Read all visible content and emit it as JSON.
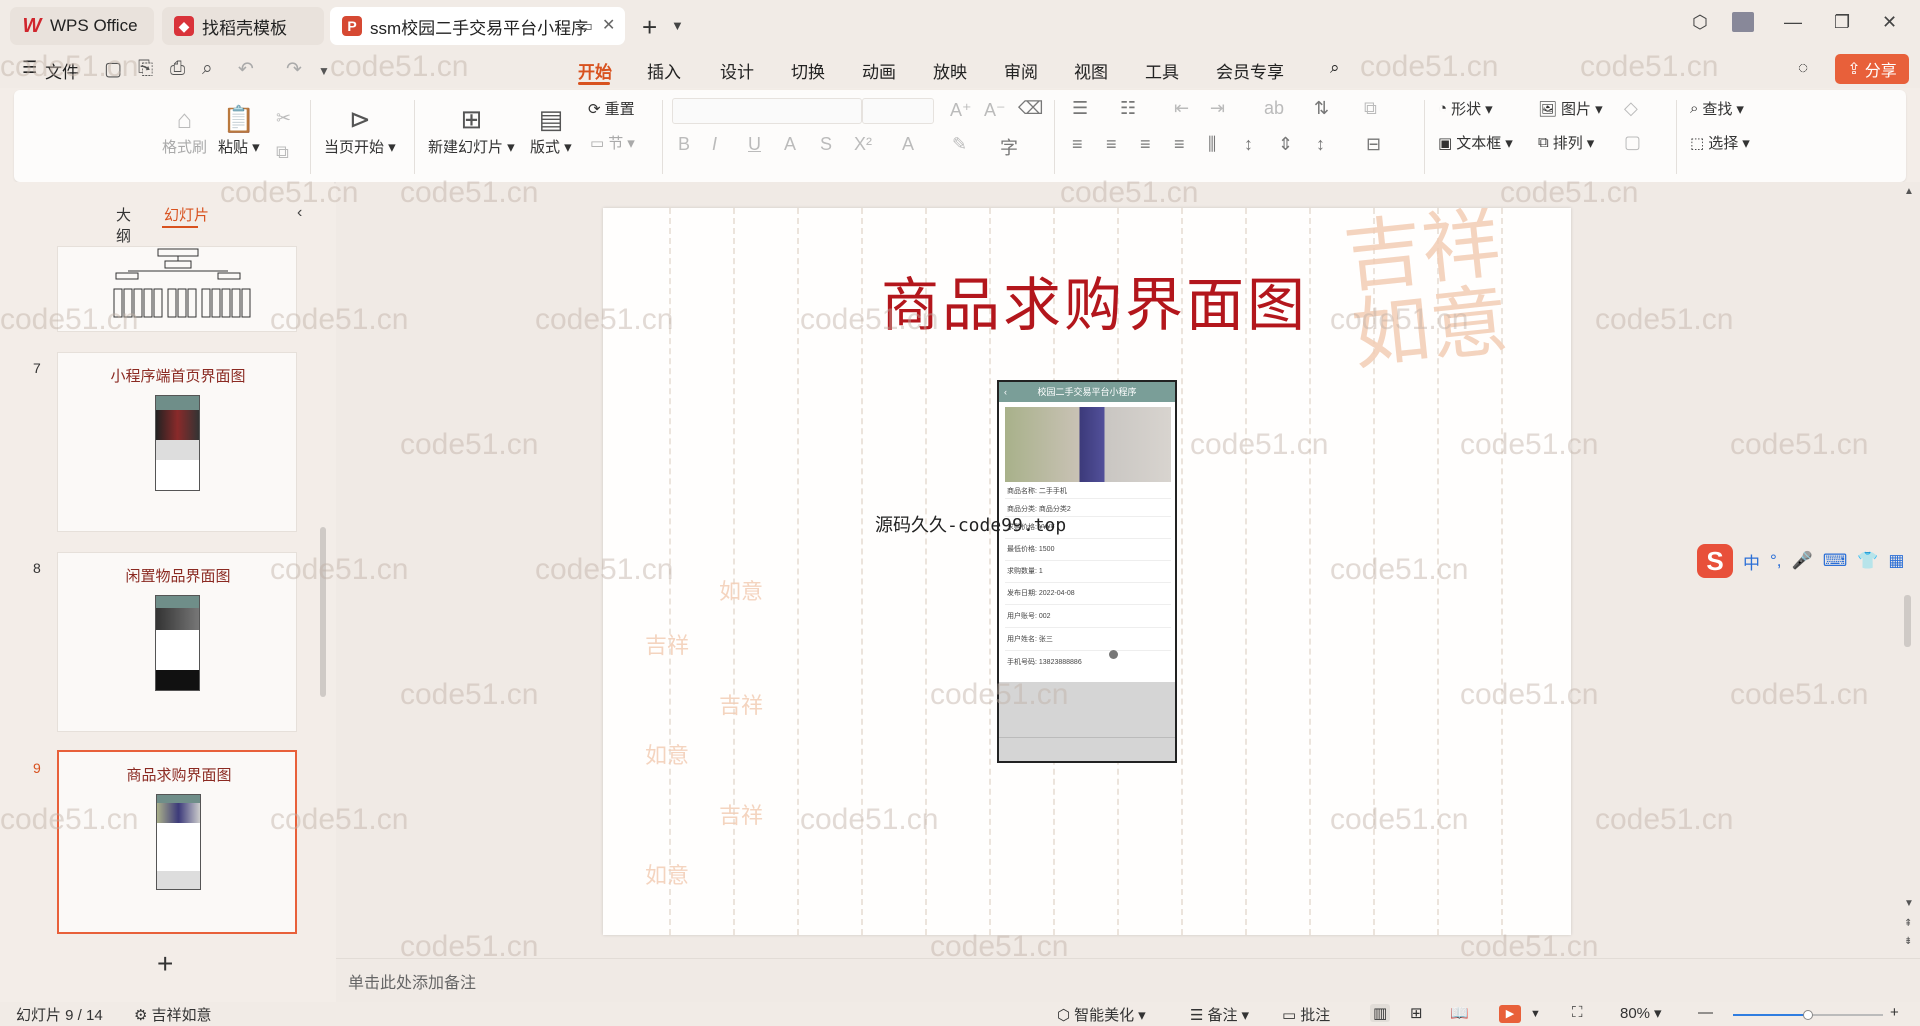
{
  "tabs": {
    "wps": {
      "label": "WPS Office",
      "icon": "wps-logo-icon"
    },
    "daoke": {
      "label": "找稻壳模板",
      "icon": "daoke-icon"
    },
    "doc": {
      "label": "ssm校园二手交易平台小程序",
      "icon": "presentation-file-icon"
    }
  },
  "menu": {
    "file": "文件",
    "start": "开始",
    "insert": "插入",
    "design": "设计",
    "switch": "切换",
    "animate": "动画",
    "show": "放映",
    "review": "审阅",
    "view": "视图",
    "tools": "工具",
    "member": "会员专享",
    "share": "分享"
  },
  "ribbon": {
    "format_painter": "格式刷",
    "paste": "粘贴",
    "from_current": "当页开始",
    "new_slide": "新建幻灯片",
    "layout": "版式",
    "reset": "重置",
    "section": "节",
    "shape": "形状",
    "picture": "图片",
    "textbox": "文本框",
    "arrange": "排列",
    "find": "查找",
    "select": "选择"
  },
  "panel": {
    "outline_tab": "大纲",
    "slides_tab": "幻灯片",
    "thumbnails": [
      {
        "num": "7",
        "title": "小程序端首页界面图"
      },
      {
        "num": "8",
        "title": "闲置物品界面图"
      },
      {
        "num": "9",
        "title": "商品求购界面图"
      }
    ]
  },
  "slide": {
    "title": "商品求购界面图",
    "overlay_text": "源码久久-code99.top",
    "seal_text": "吉祥如意",
    "phone": {
      "header": "校园二手交易平台小程序",
      "fields": [
        "商品名称:  二手手机",
        "商品分类:  商品分类2",
        "求购价格:  ¥¥¥¥",
        "最低价格:  1500",
        "求购数量:  1",
        "发布日期:  2022-04-08",
        "用户账号:  002",
        "用户姓名:  张三",
        "手机号码:  13823888886"
      ]
    }
  },
  "watermark": "code51.cn",
  "notes": {
    "placeholder": "单击此处添加备注"
  },
  "ime": {
    "lang": "中",
    "punct": "°,"
  },
  "status": {
    "slide_count": "幻灯片 9 / 14",
    "theme": "吉祥如意",
    "smart_beautify": "智能美化",
    "notes": "备注",
    "comments": "批注",
    "zoom": "80%",
    "zoom_fraction": 0.5
  },
  "colors": {
    "accent": "#d8521f",
    "title_red": "#b3161c",
    "share_bg": "#e8603a"
  }
}
